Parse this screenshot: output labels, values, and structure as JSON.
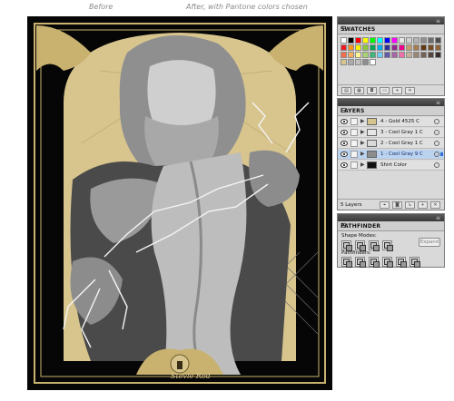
{
  "captions": {
    "before": "Before",
    "after": "After, with Pantone colors chosen"
  },
  "artwork": {
    "signature": "Stevie Rod",
    "colors": {
      "background": "#060606",
      "gold": "#d8c58e",
      "frame_gold": "#c9b26f",
      "light_gray": "#cfcfcf",
      "mid_gray": "#8f8f8f",
      "dark_gray": "#4a4a4a",
      "lightning": "#f4f4f4"
    }
  },
  "swatches_panel": {
    "tab_label": "SWATCHES",
    "menu_icon": "panel-menu-icon",
    "rows": [
      [
        "#ffffff",
        "#000000",
        "#ff0000",
        "#ffff00",
        "#00ff00",
        "#00ffff",
        "#0000ff",
        "#ff00ff",
        "#e8e8e8",
        "#d1d1d1",
        "#b3b3b3",
        "#909090",
        "#6e6e6e",
        "#4e4e4e"
      ],
      [
        "#ed1c24",
        "#f7941d",
        "#fff200",
        "#8dc63f",
        "#00a651",
        "#00aeef",
        "#2e3192",
        "#92278f",
        "#ec008c",
        "#c69c6d",
        "#a67c52",
        "#603913",
        "#754c24",
        "#8c6239"
      ],
      [
        "#f26c4f",
        "#fbaf5d",
        "#fff68f",
        "#acd373",
        "#3cb878",
        "#6dcff6",
        "#605ca8",
        "#a864a8",
        "#f06eaa",
        "#c7b299",
        "#998675",
        "#736357",
        "#534741",
        "#362f2d"
      ],
      [
        "#d8c58e",
        "#aaaaaa",
        "#c0c0c0",
        "#8f8f8f",
        "#ffffff"
      ]
    ],
    "bottom_icons": [
      "swatch-libraries-icon",
      "show-kinds-icon",
      "swatch-options-icon",
      "new-color-group-icon",
      "new-swatch-icon",
      "delete-swatch-icon"
    ]
  },
  "layers_panel": {
    "tab_label": "LAYERS",
    "layers": [
      {
        "name": "4 - Gold 4525 C",
        "thumb": "#d8c58e",
        "selected": false
      },
      {
        "name": "3 - Cool Gray 1 C",
        "thumb": "#e6e6e6",
        "selected": false
      },
      {
        "name": "2 - Cool Gray 1 C",
        "thumb": "#d9d9d9",
        "selected": false
      },
      {
        "name": "1 - Cool Gray 9 C",
        "thumb": "#8c8c8c",
        "selected": true
      },
      {
        "name": "Shirt Color",
        "thumb": "#111111",
        "selected": false
      }
    ],
    "count_label": "5 Layers",
    "bottom_icons": [
      "locate-object-icon",
      "make-clipping-mask-icon",
      "new-sublayer-icon",
      "new-layer-icon",
      "delete-layer-icon"
    ]
  },
  "pathfinder_panel": {
    "tab_label": "PATHFINDER",
    "shape_modes_label": "Shape Modes:",
    "pathfinders_label": "Pathfinders:",
    "expand_label": "Expand",
    "shape_mode_icons": [
      "unite-icon",
      "minus-front-icon",
      "intersect-icon",
      "exclude-icon"
    ],
    "pathfinder_icons": [
      "divide-icon",
      "trim-icon",
      "merge-icon",
      "crop-icon",
      "outline-icon",
      "minus-back-icon"
    ]
  }
}
